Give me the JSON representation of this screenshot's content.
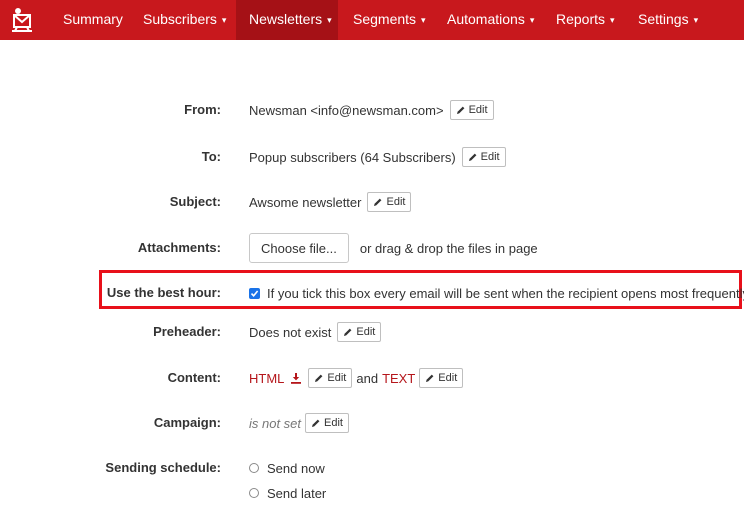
{
  "nav": {
    "items": [
      {
        "label": "Summary",
        "caret": false,
        "active": false
      },
      {
        "label": "Subscribers",
        "caret": true,
        "active": false
      },
      {
        "label": "Newsletters",
        "caret": true,
        "active": true
      },
      {
        "label": "Segments",
        "caret": true,
        "active": false
      },
      {
        "label": "Automations",
        "caret": true,
        "active": false
      },
      {
        "label": "Reports",
        "caret": true,
        "active": false
      },
      {
        "label": "Settings",
        "caret": true,
        "active": false
      }
    ],
    "caret_glyph": "▾"
  },
  "colors": {
    "brand": "#c8181d",
    "active_tab": "#a51116",
    "highlight": "#e8101a",
    "link": "#b5161b"
  },
  "form": {
    "edit_label": "Edit",
    "from": {
      "label": "From:",
      "value": "Newsman <info@newsman.com>"
    },
    "to": {
      "label": "To:",
      "value": "Popup subscribers (64 Subscribers)"
    },
    "subject": {
      "label": "Subject:",
      "value": "Awsome newsletter"
    },
    "attachments": {
      "label": "Attachments:",
      "button": "Choose file...",
      "hint": "or drag & drop the files in page"
    },
    "best_hour": {
      "label": "Use the best hour:",
      "checked": true,
      "text": "If you tick this box every email will be sent when the recipient opens most frequently"
    },
    "preheader": {
      "label": "Preheader:",
      "value": "Does not exist"
    },
    "content": {
      "label": "Content:",
      "html": "HTML",
      "and": "and",
      "text": "TEXT"
    },
    "campaign": {
      "label": "Campaign:",
      "value": "is not set"
    },
    "schedule": {
      "label": "Sending schedule:",
      "options": [
        "Send now",
        "Send later"
      ]
    }
  }
}
